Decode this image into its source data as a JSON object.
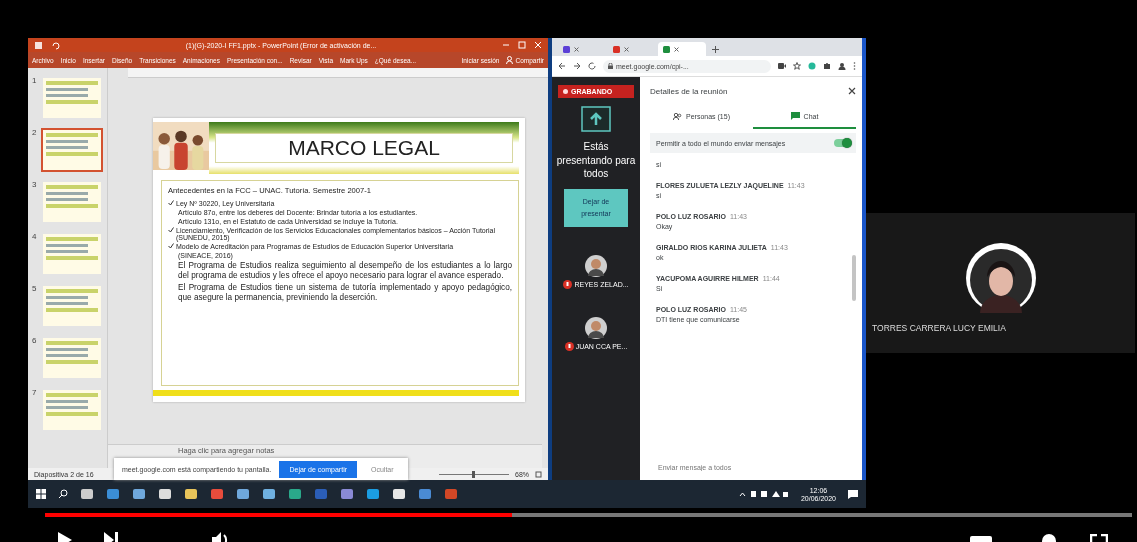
{
  "powerpoint": {
    "title": "(1)(G)-2020-I FF1.pptx - PowerPoint (Error de activación de...",
    "ribbon_tabs": [
      "Archivo",
      "Inicio",
      "Insertar",
      "Diseño",
      "Transiciones",
      "Animaciones",
      "Presentación con...",
      "Revisar",
      "Vista",
      "Mark Ups",
      "¿Qué desea..."
    ],
    "sign_in": "Iniciar sesión",
    "share": "Compartir",
    "thumbnails": [
      {
        "number": "1",
        "selected": false
      },
      {
        "number": "2",
        "selected": true
      },
      {
        "number": "3",
        "selected": false
      },
      {
        "number": "4",
        "selected": false
      },
      {
        "number": "5",
        "selected": false
      },
      {
        "number": "6",
        "selected": false
      },
      {
        "number": "7",
        "selected": false
      }
    ],
    "slide": {
      "title": "MARCO LEGAL",
      "heading": "Antecedentes en la FCC – UNAC. Tutoría. Semestre 2007-1",
      "items": [
        {
          "kind": "bullet",
          "text": "Ley Nº 30220, Ley Universitaria"
        },
        {
          "kind": "sub",
          "text": "Artículo 87o, entre los deberes del Docente: Brindar tutoría a los estudiantes."
        },
        {
          "kind": "sub",
          "text": "Artículo 131o, en el Estatuto de cada Universidad se incluye la Tutoría."
        },
        {
          "kind": "bullet",
          "text": "Licenciamiento, Verificación de los Servicios Educacionales complementarios básicos – Acción Tutorial (SUNEDU, 2015)"
        },
        {
          "kind": "bullet",
          "text": "Modelo de Acreditación para Programas de Estudios de Educación Superior Universitaria"
        },
        {
          "kind": "source",
          "text": "(SINEACE, 2016)"
        },
        {
          "kind": "paragraph",
          "text": "El Programa de Estudios realiza seguimiento al desempeño de los estudiantes a lo largo del programa de estudios y les ofrece el apoyo necesario para lograr el avance esperado."
        },
        {
          "kind": "paragraph",
          "text": "El Programa de Estudios tiene un sistema de tutoría implementado y apoyo pedagógico, que asegure la permanencia, previniendo la deserción."
        }
      ]
    },
    "notes_placeholder": "Haga clic para agregar notas",
    "status": "Diapositiva 2 de 16",
    "zoom": {
      "level": 0.5,
      "reading": "68%"
    }
  },
  "share_bar": {
    "message": "meet.google.com está compartiendo tu pantalla.",
    "stop_button": "Dejar de compartir",
    "hide_button": "Ocultar"
  },
  "browser": {
    "tabs": [
      {
        "selected": false
      },
      {
        "selected": false
      },
      {
        "selected": true
      }
    ],
    "address": "meet.google.com/cpi-..."
  },
  "meet": {
    "recording": "GRABANDO",
    "presenting": "Estás presentando para todos",
    "stop_presenting": "Dejar de presentar",
    "participants": [
      {
        "name": "REYES ZELAD..."
      },
      {
        "name": "JUAN CCA PE..."
      }
    ]
  },
  "chat_panel": {
    "title": "Detalles de la reunión",
    "tabs": [
      {
        "label": "Personas (15)",
        "selected": false
      },
      {
        "label": "Chat",
        "selected": true
      }
    ],
    "toggle": {
      "label": "Permitir a todo el mundo enviar mensajes",
      "on": true
    },
    "first_message_text": "si",
    "messages": [
      {
        "sender": "FLORES ZULUETA LEZLY JAQUELINE",
        "time": "11:43",
        "text": "si"
      },
      {
        "sender": "POLO LUZ ROSARIO",
        "time": "11:43",
        "text": "Okay"
      },
      {
        "sender": "GIRALDO RIOS KARINA JULIETA",
        "time": "11:43",
        "text": "ok"
      },
      {
        "sender": "YACUPOMA AGUIRRE HILMER",
        "time": "11:44",
        "text": "Si"
      },
      {
        "sender": "POLO LUZ ROSARIO",
        "time": "11:45",
        "text": "DTI tiene que comunicarse"
      }
    ],
    "input": {
      "placeholder": "Enviar mensaje a todos"
    }
  },
  "taskbar": {
    "time": "12:06",
    "date": "20/06/2020"
  },
  "speaker": {
    "name": "TORRES CARRERA LUCY EMILIA"
  },
  "player": {
    "progress": {
      "level": 0.43
    }
  }
}
